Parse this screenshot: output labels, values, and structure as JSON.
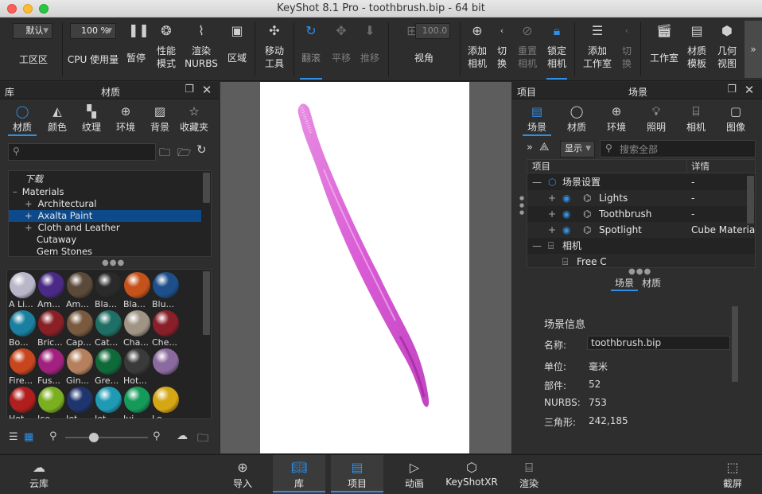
{
  "window": {
    "title": "KeyShot 8.1 Pro  - toothbrush.bip  - 64 bit"
  },
  "ribbon": {
    "workspace_value": "默认",
    "workspace_label": "工区区",
    "cpu_value": "100 %",
    "cpu_label": "CPU 使用量",
    "pause_label": "暂停",
    "perf_label_1": "性能",
    "perf_label_2": "模式",
    "render_nurbs_1": "渲染",
    "render_nurbs_2": "NURBS",
    "region_label": "区域",
    "move_tool_1": "移动",
    "move_tool_2": "工具",
    "tumble_label": "翻滚",
    "pan_label": "平移",
    "dolly_label": "推移",
    "fov_value": "100.0",
    "view_angle_label": "视角",
    "add_camera_1": "添加",
    "add_camera_2": "相机",
    "switch_cam_1": "切",
    "switch_cam_2": "换",
    "reset_cam_1": "重置",
    "reset_cam_2": "相机",
    "lock_cam_1": "锁定",
    "lock_cam_2": "相机",
    "add_studio_1": "添加",
    "add_studio_2": "工作室",
    "switch_studio_1": "切",
    "switch_studio_2": "换",
    "studio_label": "工作室",
    "material_template_1": "材质",
    "material_template_2": "模板",
    "geometry_view_1": "几何",
    "geometry_view_2": "视图",
    "more": "»"
  },
  "library": {
    "header_left": "库",
    "header_center": "材质",
    "tabs": [
      "材质",
      "颜色",
      "纹理",
      "环境",
      "背景",
      "收藏夹"
    ],
    "tree": [
      "下载",
      "Materials",
      "Architectural",
      "Axalta Paint",
      "Cloth and Leather",
      "Cutaway",
      "Gem Stones"
    ],
    "swatch_labels": [
      "A Li...",
      "Am...",
      "Am...",
      "Bla...",
      "Bla...",
      "Blu...",
      "Bo...",
      "Bric...",
      "Cap...",
      "Cat...",
      "Cha...",
      "Che...",
      "Fire...",
      "Fus...",
      "Gin...",
      "Gre...",
      "Hot...",
      "",
      "Hot...",
      "Ice...",
      "Jet...",
      "Jet...",
      "Jui...",
      "Le..."
    ],
    "swatch_colors": [
      "#b9b6c9",
      "#4a2a86",
      "#5b4a3a",
      "#2a2a2a",
      "#c5521a",
      "#1d4f8a",
      "#1a7fa0",
      "#8a1f26",
      "#7a5a3e",
      "#1f6f66",
      "#a09485",
      "#8a1f2a",
      "#c8461e",
      "#a2207e",
      "#b5805e",
      "#0f6a3a",
      "#3a3a3a",
      "#8b6aa0",
      "#b01e1e",
      "#7ab020",
      "#20346e",
      "#1f9ab5",
      "#169a5a",
      "#d6a715"
    ]
  },
  "project": {
    "header_left": "项目",
    "header_center": "场景",
    "tabs": [
      "场景",
      "材质",
      "环境",
      "照明",
      "相机",
      "图像"
    ],
    "display_label": "显示",
    "search_placeholder": "搜索全部",
    "table_headers": [
      "项目",
      "详情"
    ],
    "rows": [
      {
        "name": "场景设置",
        "detail": "-"
      },
      {
        "name": "Lights",
        "detail": "-"
      },
      {
        "name": "Toothbrush",
        "detail": "-"
      },
      {
        "name": "Spotlight",
        "detail": "Cube Materia"
      },
      {
        "name": "相机",
        "detail": ""
      },
      {
        "name": "Free C",
        "detail": ""
      }
    ],
    "sub_tabs": [
      "场景",
      "材质"
    ],
    "info_title": "场景信息",
    "info": {
      "name_label": "名称:",
      "name_value": "toothbrush.bip",
      "unit_label": "单位:",
      "unit_value": "毫米",
      "parts_label": "部件:",
      "parts_value": "52",
      "nurbs_label": "NURBS:",
      "nurbs_value": "753",
      "tri_label": "三角形:",
      "tri_value": "242,185"
    }
  },
  "bottom": [
    "云库",
    "导入",
    "库",
    "项目",
    "动画",
    "KeyShotXR",
    "渲染",
    "截屏"
  ]
}
